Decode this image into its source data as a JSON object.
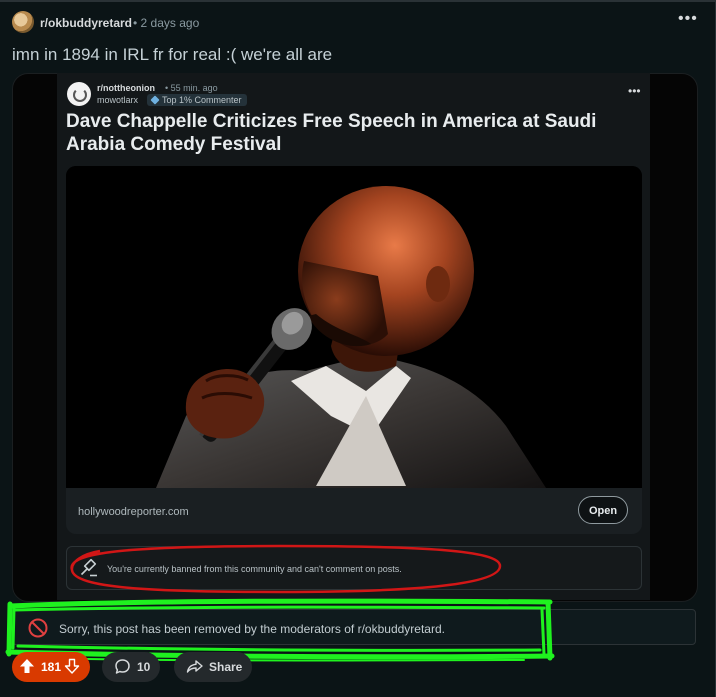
{
  "post": {
    "subreddit": "r/okbuddyretard",
    "time": "• 2 days ago",
    "more": "•••",
    "title": "imn in 1894 in IRL fr for real :( we're all are"
  },
  "embed": {
    "subreddit": "r/nottheonion",
    "time": "• 55 min. ago",
    "user": "mowotlarx",
    "badge": "Top 1% Commenter",
    "more": "•••",
    "headline": "Dave Chappelle Criticizes Free Speech in America at Saudi Arabia Comedy Festival",
    "domain": "hollywoodreporter.com",
    "open_label": "Open",
    "banned_text": "You're currently banned from this community and can't comment on posts."
  },
  "removed_text": "Sorry, this post has been removed by the moderators of r/okbuddyretard.",
  "actions": {
    "votes": "181",
    "comments": "10",
    "share_label": "Share"
  },
  "icons": {
    "subreddit_avatar": "subreddit-avatar-icon",
    "gavel": "gavel-icon",
    "removed": "ban-icon",
    "upvote": "upvote-arrow-icon",
    "downvote": "downvote-arrow-icon",
    "comment": "comment-bubble-icon",
    "share": "share-arrow-icon"
  },
  "colors": {
    "background": "#0b1416",
    "upvote_active": "#d93a00",
    "red_annotation": "#d11616",
    "green_annotation": "#1ff21f"
  }
}
